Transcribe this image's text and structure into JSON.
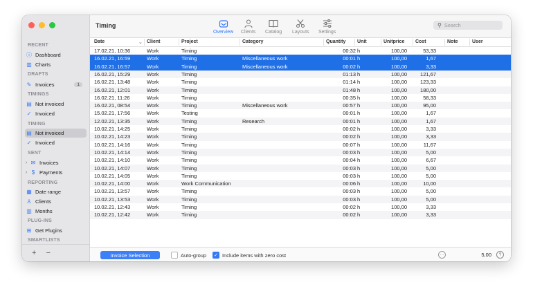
{
  "sidebar": {
    "sections": [
      {
        "id": "recent",
        "label": "RECENT"
      },
      {
        "id": "drafts",
        "label": "DRAFTS"
      },
      {
        "id": "timings",
        "label": "TIMINGS"
      },
      {
        "id": "timing",
        "label": "TIMING"
      },
      {
        "id": "sent",
        "label": "SENT"
      },
      {
        "id": "reporting",
        "label": "REPORTING"
      },
      {
        "id": "plugins",
        "label": "PLUG-INS"
      },
      {
        "id": "smartlists",
        "label": "SMARTLISTS"
      }
    ],
    "items": [
      {
        "label": "Dashboard",
        "icon": "info-icon"
      },
      {
        "label": "Charts",
        "icon": "chart-icon"
      },
      {
        "label": "Invoices",
        "icon": "pencil-icon",
        "badge": "1"
      },
      {
        "label": "Not invoiced",
        "icon": "stack-icon"
      },
      {
        "label": "Invoiced",
        "icon": "check-circle-icon"
      },
      {
        "label": "Not invoiced",
        "icon": "stack-icon",
        "selected": true
      },
      {
        "label": "Invoiced",
        "icon": "check-circle-icon"
      },
      {
        "label": "Invoices",
        "icon": "envelope-icon",
        "expandable": true
      },
      {
        "label": "Payments",
        "icon": "dollar-circle-icon",
        "expandable": true
      },
      {
        "label": "Date range",
        "icon": "calendar-icon"
      },
      {
        "label": "Clients",
        "icon": "person-icon"
      },
      {
        "label": "Months",
        "icon": "chart-icon"
      },
      {
        "label": "Get Plugins",
        "icon": "plus-square-icon"
      }
    ],
    "add_label": "+",
    "remove_label": "−"
  },
  "toolbar": {
    "title": "Timing",
    "tools": [
      {
        "label": "Overview",
        "icon": "overview-icon",
        "active": true
      },
      {
        "label": "Clients",
        "icon": "person-icon",
        "active": false
      },
      {
        "label": "Catalog",
        "icon": "book-icon",
        "active": false
      },
      {
        "label": "Layouts",
        "icon": "scissors-icon",
        "active": false
      },
      {
        "label": "Settings",
        "icon": "sliders-icon",
        "active": false
      }
    ],
    "search_placeholder": "Search"
  },
  "table": {
    "columns": [
      "Date",
      "Client",
      "Project",
      "Category",
      "Quantity",
      "Unit",
      "Unitprice",
      "Cost",
      "Note",
      "User"
    ],
    "sort_indicator": "⌄",
    "rows": [
      {
        "date": "17.02.21, 10:36",
        "client": "Work",
        "project": "Timing",
        "category": "",
        "qty": "00:32",
        "unit": "h",
        "price": "100,00",
        "cost": "53,33",
        "sel": false
      },
      {
        "date": "16.02.21, 16:59",
        "client": "Work",
        "project": "Timing",
        "category": "Miscellaneous work",
        "qty": "00:01",
        "unit": "h",
        "price": "100,00",
        "cost": "1,67",
        "sel": true
      },
      {
        "date": "16.02.21, 16:57",
        "client": "Work",
        "project": "Timing",
        "category": "Miscellaneous work",
        "qty": "00:02",
        "unit": "h",
        "price": "100,00",
        "cost": "3,33",
        "sel": true
      },
      {
        "date": "16.02.21, 15:29",
        "client": "Work",
        "project": "Timing",
        "category": "",
        "qty": "01:13",
        "unit": "h",
        "price": "100,00",
        "cost": "121,67",
        "sel": false
      },
      {
        "date": "16.02.21, 13:48",
        "client": "Work",
        "project": "Timing",
        "category": "",
        "qty": "01:14",
        "unit": "h",
        "price": "100,00",
        "cost": "123,33",
        "sel": false
      },
      {
        "date": "16.02.21, 12:01",
        "client": "Work",
        "project": "Timing",
        "category": "",
        "qty": "01:48",
        "unit": "h",
        "price": "100,00",
        "cost": "180,00",
        "sel": false
      },
      {
        "date": "16.02.21, 11:26",
        "client": "Work",
        "project": "Timing",
        "category": "",
        "qty": "00:35",
        "unit": "h",
        "price": "100,00",
        "cost": "58,33",
        "sel": false
      },
      {
        "date": "16.02.21, 08:54",
        "client": "Work",
        "project": "Timing",
        "category": "Miscellaneous work",
        "qty": "00:57",
        "unit": "h",
        "price": "100,00",
        "cost": "95,00",
        "sel": false
      },
      {
        "date": "15.02.21, 17:56",
        "client": "Work",
        "project": "Testing",
        "category": "",
        "qty": "00:01",
        "unit": "h",
        "price": "100,00",
        "cost": "1,67",
        "sel": false
      },
      {
        "date": "12.02.21, 13:35",
        "client": "Work",
        "project": "Timing",
        "category": "Research",
        "qty": "00:01",
        "unit": "h",
        "price": "100,00",
        "cost": "1,67",
        "sel": false
      },
      {
        "date": "10.02.21, 14:25",
        "client": "Work",
        "project": "Timing",
        "category": "",
        "qty": "00:02",
        "unit": "h",
        "price": "100,00",
        "cost": "3,33",
        "sel": false
      },
      {
        "date": "10.02.21, 14:23",
        "client": "Work",
        "project": "Timing",
        "category": "",
        "qty": "00:02",
        "unit": "h",
        "price": "100,00",
        "cost": "3,33",
        "sel": false
      },
      {
        "date": "10.02.21, 14:16",
        "client": "Work",
        "project": "Timing",
        "category": "",
        "qty": "00:07",
        "unit": "h",
        "price": "100,00",
        "cost": "11,67",
        "sel": false
      },
      {
        "date": "10.02.21, 14:14",
        "client": "Work",
        "project": "Timing",
        "category": "",
        "qty": "00:03",
        "unit": "h",
        "price": "100,00",
        "cost": "5,00",
        "sel": false
      },
      {
        "date": "10.02.21, 14:10",
        "client": "Work",
        "project": "Timing",
        "category": "",
        "qty": "00:04",
        "unit": "h",
        "price": "100,00",
        "cost": "6,67",
        "sel": false
      },
      {
        "date": "10.02.21, 14:07",
        "client": "Work",
        "project": "Timing",
        "category": "",
        "qty": "00:03",
        "unit": "h",
        "price": "100,00",
        "cost": "5,00",
        "sel": false
      },
      {
        "date": "10.02.21, 14:05",
        "client": "Work",
        "project": "Timing",
        "category": "",
        "qty": "00:03",
        "unit": "h",
        "price": "100,00",
        "cost": "5,00",
        "sel": false
      },
      {
        "date": "10.02.21, 14:00",
        "client": "Work",
        "project": "Work Communication",
        "category": "",
        "qty": "00:06",
        "unit": "h",
        "price": "100,00",
        "cost": "10,00",
        "sel": false
      },
      {
        "date": "10.02.21, 13:57",
        "client": "Work",
        "project": "Timing",
        "category": "",
        "qty": "00:03",
        "unit": "h",
        "price": "100,00",
        "cost": "5,00",
        "sel": false
      },
      {
        "date": "10.02.21, 13:53",
        "client": "Work",
        "project": "Timing",
        "category": "",
        "qty": "00:03",
        "unit": "h",
        "price": "100,00",
        "cost": "5,00",
        "sel": false
      },
      {
        "date": "10.02.21, 12:43",
        "client": "Work",
        "project": "Timing",
        "category": "",
        "qty": "00:02",
        "unit": "h",
        "price": "100,00",
        "cost": "3,33",
        "sel": false
      },
      {
        "date": "10.02.21, 12:42",
        "client": "Work",
        "project": "Timing",
        "category": "",
        "qty": "00:02",
        "unit": "h",
        "price": "100,00",
        "cost": "3,33",
        "sel": false
      }
    ]
  },
  "footer": {
    "invoice_button": "Invoice Selection",
    "autogroup_label": "Auto-group",
    "autogroup_checked": false,
    "include_zero_label": "Include items with zero cost",
    "include_zero_checked": true,
    "more_label": "···",
    "total": "5,00",
    "help_label": "?"
  },
  "colors": {
    "accent": "#3478f6",
    "selection": "#1f6fe6",
    "sidebar_bg": "#e6e6e9"
  }
}
